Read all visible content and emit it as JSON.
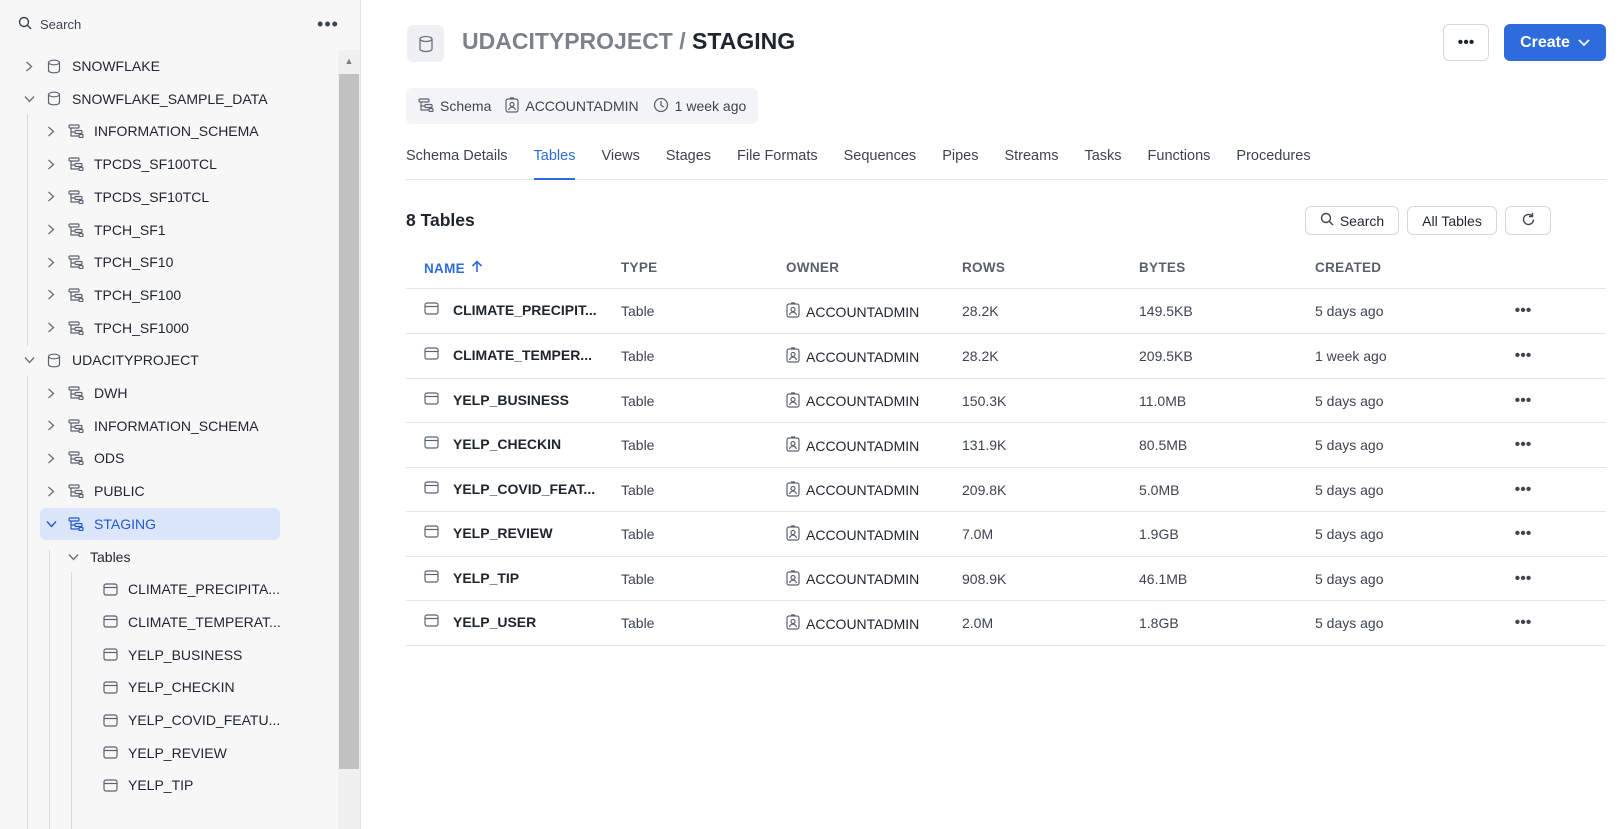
{
  "sidebar": {
    "search_label": "Search",
    "more_label": "•••",
    "tree": [
      {
        "label": "SNOWFLAKE",
        "icon": "database-icon",
        "chevron": "right"
      },
      {
        "label": "SNOWFLAKE_SAMPLE_DATA",
        "icon": "database-icon",
        "chevron": "down"
      },
      {
        "label": "INFORMATION_SCHEMA",
        "icon": "schema-icon",
        "chevron": "right"
      },
      {
        "label": "TPCDS_SF100TCL",
        "icon": "schema-icon",
        "chevron": "right"
      },
      {
        "label": "TPCDS_SF10TCL",
        "icon": "schema-icon",
        "chevron": "right"
      },
      {
        "label": "TPCH_SF1",
        "icon": "schema-icon",
        "chevron": "right"
      },
      {
        "label": "TPCH_SF10",
        "icon": "schema-icon",
        "chevron": "right"
      },
      {
        "label": "TPCH_SF100",
        "icon": "schema-icon",
        "chevron": "right"
      },
      {
        "label": "TPCH_SF1000",
        "icon": "schema-icon",
        "chevron": "right"
      },
      {
        "label": "UDACITYPROJECT",
        "icon": "database-icon",
        "chevron": "down"
      },
      {
        "label": "DWH",
        "icon": "schema-icon",
        "chevron": "right"
      },
      {
        "label": "INFORMATION_SCHEMA",
        "icon": "schema-icon",
        "chevron": "right"
      },
      {
        "label": "ODS",
        "icon": "schema-icon",
        "chevron": "right"
      },
      {
        "label": "PUBLIC",
        "icon": "schema-icon",
        "chevron": "right"
      },
      {
        "label": "STAGING",
        "icon": "schema-icon",
        "chevron": "down",
        "selected": true
      },
      {
        "label": "Tables",
        "icon": "",
        "chevron": "down"
      },
      {
        "label": "CLIMATE_PRECIPITA...",
        "icon": "table-icon"
      },
      {
        "label": "CLIMATE_TEMPERAT...",
        "icon": "table-icon"
      },
      {
        "label": "YELP_BUSINESS",
        "icon": "table-icon"
      },
      {
        "label": "YELP_CHECKIN",
        "icon": "table-icon"
      },
      {
        "label": "YELP_COVID_FEATU...",
        "icon": "table-icon"
      },
      {
        "label": "YELP_REVIEW",
        "icon": "table-icon"
      },
      {
        "label": "YELP_TIP",
        "icon": "table-icon"
      }
    ]
  },
  "header": {
    "parent": "UDACITYPROJECT",
    "separator": "/",
    "current": "STAGING",
    "more_label": "•••",
    "create_label": "Create"
  },
  "meta": {
    "kind": "Schema",
    "owner": "ACCOUNTADMIN",
    "age": "1 week ago"
  },
  "tabs": [
    {
      "label": "Schema Details",
      "active": false
    },
    {
      "label": "Tables",
      "active": true
    },
    {
      "label": "Views",
      "active": false
    },
    {
      "label": "Stages",
      "active": false
    },
    {
      "label": "File Formats",
      "active": false
    },
    {
      "label": "Sequences",
      "active": false
    },
    {
      "label": "Pipes",
      "active": false
    },
    {
      "label": "Streams",
      "active": false
    },
    {
      "label": "Tasks",
      "active": false
    },
    {
      "label": "Functions",
      "active": false
    },
    {
      "label": "Procedures",
      "active": false
    }
  ],
  "list": {
    "count_title": "8 Tables",
    "search_label": "Search",
    "filter_label": "All Tables",
    "columns": {
      "name": "NAME",
      "type": "TYPE",
      "owner": "OWNER",
      "rows": "ROWS",
      "bytes": "BYTES",
      "created": "CREATED"
    },
    "rows": [
      {
        "name": "CLIMATE_PRECIPIT...",
        "type": "Table",
        "owner": "ACCOUNTADMIN",
        "rows": "28.2K",
        "bytes": "149.5KB",
        "created": "5 days ago"
      },
      {
        "name": "CLIMATE_TEMPER...",
        "type": "Table",
        "owner": "ACCOUNTADMIN",
        "rows": "28.2K",
        "bytes": "209.5KB",
        "created": "1 week ago"
      },
      {
        "name": "YELP_BUSINESS",
        "type": "Table",
        "owner": "ACCOUNTADMIN",
        "rows": "150.3K",
        "bytes": "11.0MB",
        "created": "5 days ago"
      },
      {
        "name": "YELP_CHECKIN",
        "type": "Table",
        "owner": "ACCOUNTADMIN",
        "rows": "131.9K",
        "bytes": "80.5MB",
        "created": "5 days ago"
      },
      {
        "name": "YELP_COVID_FEAT...",
        "type": "Table",
        "owner": "ACCOUNTADMIN",
        "rows": "209.8K",
        "bytes": "5.0MB",
        "created": "5 days ago"
      },
      {
        "name": "YELP_REVIEW",
        "type": "Table",
        "owner": "ACCOUNTADMIN",
        "rows": "7.0M",
        "bytes": "1.9GB",
        "created": "5 days ago"
      },
      {
        "name": "YELP_TIP",
        "type": "Table",
        "owner": "ACCOUNTADMIN",
        "rows": "908.9K",
        "bytes": "46.1MB",
        "created": "5 days ago"
      },
      {
        "name": "YELP_USER",
        "type": "Table",
        "owner": "ACCOUNTADMIN",
        "rows": "2.0M",
        "bytes": "1.8GB",
        "created": "5 days ago"
      }
    ],
    "row_more_label": "•••"
  },
  "colors": {
    "accent": "#2e6bdd",
    "selected_bg": "#dbe6fb",
    "sidebar_bg": "#f7f7f8"
  }
}
